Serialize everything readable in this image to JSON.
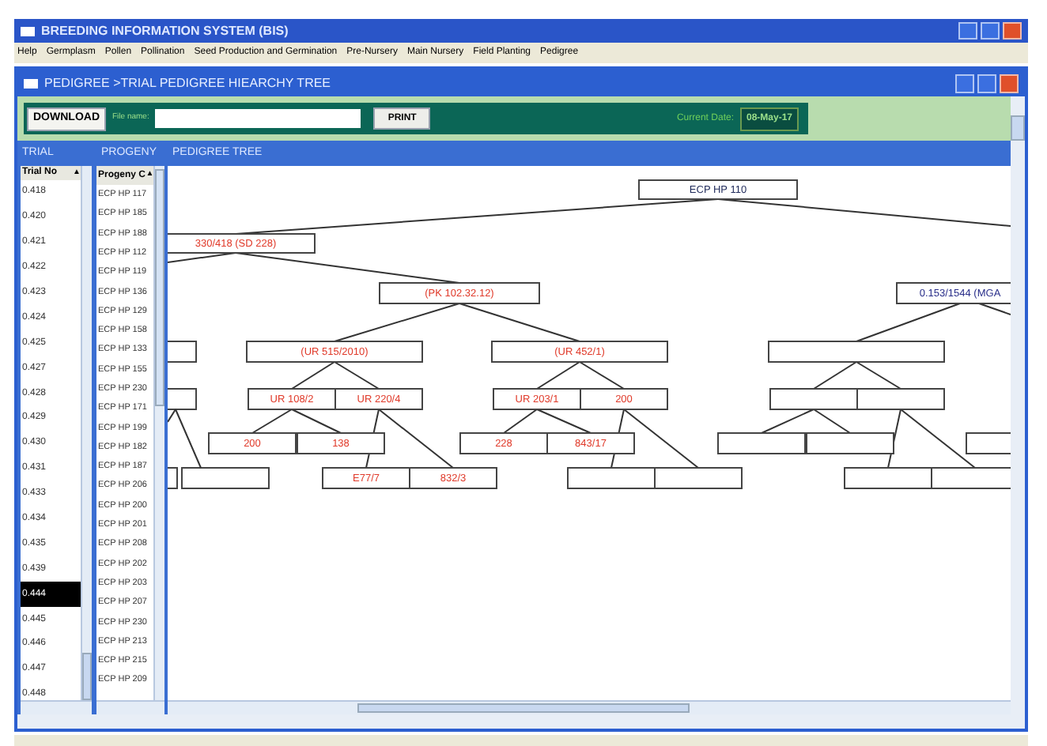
{
  "window": {
    "title": "BREEDING INFORMATION SYSTEM (BIS)"
  },
  "menu": [
    "Help",
    "Germplasm",
    "Pollen",
    "Pollination",
    "Seed Production and Germination",
    "Pre-Nursery",
    "Main Nursery",
    "Field Planting",
    "Pedigree"
  ],
  "child_window": {
    "title": "PEDIGREE >TRIAL PEDIGREE HIEARCHY TREE"
  },
  "toolbar": {
    "download_button": "DOWNLOAD",
    "file_name_label": "File name:",
    "print_button": "PRINT",
    "current_date_label": "Current Date:",
    "current_date": "08-May-17"
  },
  "trial_panel": {
    "heading": "TRIAL",
    "column": "Trial No",
    "sort_icon": "▲",
    "rows": [
      {
        "text": "0.418",
        "selected": false
      },
      {
        "text": "0.420",
        "selected": false
      },
      {
        "text": "0.421",
        "selected": false
      },
      {
        "text": "0.422",
        "selected": false
      },
      {
        "text": "0.423",
        "selected": false
      },
      {
        "text": "0.424",
        "selected": false
      },
      {
        "text": "0.425",
        "selected": false
      },
      {
        "text": "0.427",
        "selected": false
      },
      {
        "text": "0.428",
        "selected": false
      },
      {
        "text": "0.429",
        "selected": false
      },
      {
        "text": "0.430",
        "selected": false
      },
      {
        "text": "0.431",
        "selected": false
      },
      {
        "text": "0.433",
        "selected": false
      },
      {
        "text": "0.434",
        "selected": false
      },
      {
        "text": "0.435",
        "selected": false
      },
      {
        "text": "0.439",
        "selected": false
      },
      {
        "text": "0.444",
        "selected": true
      },
      {
        "text": "0.445",
        "selected": false
      },
      {
        "text": "0.446",
        "selected": false
      },
      {
        "text": "0.447",
        "selected": false
      },
      {
        "text": "0.448",
        "selected": false
      }
    ]
  },
  "progeny_panel": {
    "heading": "PROGENY",
    "column": "Progeny C",
    "sort_icon": "▲",
    "rows": [
      "ECP HP 117",
      "ECP HP 185",
      "ECP HP 188",
      "ECP HP 112",
      "ECP HP 119",
      "ECP HP 136",
      "ECP HP 129",
      "ECP HP 158",
      "ECP HP 133",
      "ECP HP 155",
      "ECP HP 230",
      "ECP HP 171",
      "ECP HP 199",
      "ECP HP 182",
      "ECP HP 187",
      "ECP HP 206",
      "ECP HP 200",
      "ECP HP 201",
      "ECP HP 208",
      "ECP HP 202",
      "ECP HP 203",
      "ECP HP 207",
      "ECP HP 230",
      "ECP HP 213",
      "ECP HP 215",
      "ECP HP 209"
    ]
  },
  "pedigree_tree": {
    "heading": "PEDIGREE TREE",
    "roots": [
      {
        "label": "ECP HP 110",
        "color": "#1f2a5a",
        "children": [
          {
            "label": "330/418 (SD 228)",
            "color": "#e03a2a",
            "children": [
              {
                "label": "(PK 102.32.12)",
                "color": "#e03a2a",
                "children": [
                  {
                    "label": "(UR 515/2010)",
                    "color": "#e03a2a",
                    "children": [
                      {
                        "label": "UR 108/2",
                        "color": "#e03a2a",
                        "children": [
                          {
                            "label": "200",
                            "color": "#e03a2a"
                          },
                          {
                            "label": "138",
                            "color": "#e03a2a"
                          }
                        ]
                      },
                      {
                        "label": "UR 220/4",
                        "color": "#e03a2a",
                        "children": [
                          {
                            "label": "E77/7",
                            "color": "#e03a2a"
                          },
                          {
                            "label": "832/3",
                            "color": "#e03a2a"
                          }
                        ]
                      }
                    ]
                  },
                  {
                    "label": "(UR 452/1)",
                    "color": "#e03a2a",
                    "children": [
                      {
                        "label": "UR 203/1",
                        "color": "#e03a2a",
                        "children": [
                          {
                            "label": "228",
                            "color": "#e03a2a"
                          },
                          {
                            "label": "843/17",
                            "color": "#e03a2a"
                          }
                        ]
                      },
                      {
                        "label": "200",
                        "color": "#e03a2a",
                        "children": [
                          {
                            "kind": "blank"
                          },
                          {
                            "kind": "blank"
                          }
                        ]
                      }
                    ]
                  }
                ]
              }
            ]
          }
        ]
      },
      {
        "label": "0.153/1544 (MGA",
        "color": "#2a2f8a",
        "children": [
          {
            "kind": "blank",
            "children": [
              {
                "kind": "blank",
                "children": [
                  {
                    "kind": "blank"
                  },
                  {
                    "kind": "blank"
                  }
                ]
              },
              {
                "kind": "blank",
                "children": [
                  {
                    "kind": "blank"
                  },
                  {
                    "kind": "blank"
                  }
                ]
              }
            ]
          }
        ]
      }
    ]
  }
}
